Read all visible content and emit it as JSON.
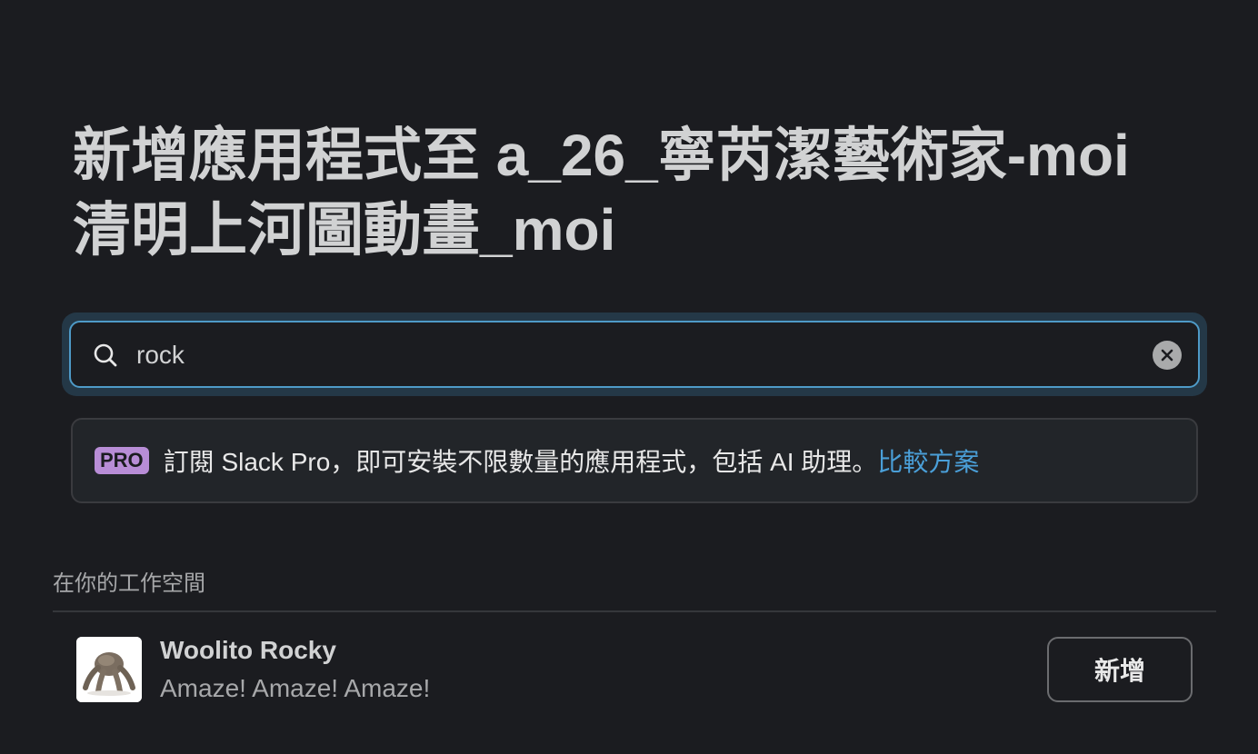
{
  "header": {
    "title_line1": "新增應用程式至 a_26_寧芮潔藝術家-moi",
    "title_line2": "清明上河圖動畫_moi"
  },
  "search": {
    "value": "rock",
    "placeholder": "",
    "clear_icon": "close-icon",
    "search_icon": "search-icon"
  },
  "promo": {
    "badge": "PRO",
    "text": "訂閱 Slack Pro，即可安裝不限數量的應用程式，包括 AI 助理。",
    "link": "比較方案"
  },
  "section": {
    "label": "在你的工作空間"
  },
  "apps": [
    {
      "name": "Woolito Rocky",
      "description": "Amaze! Amaze! Amaze!",
      "button_label": "新增"
    }
  ],
  "colors": {
    "background": "#1b1c20",
    "focus_ring": "#4e9ac7",
    "pro_badge": "#b88dd6",
    "link": "#4a9fd8"
  }
}
